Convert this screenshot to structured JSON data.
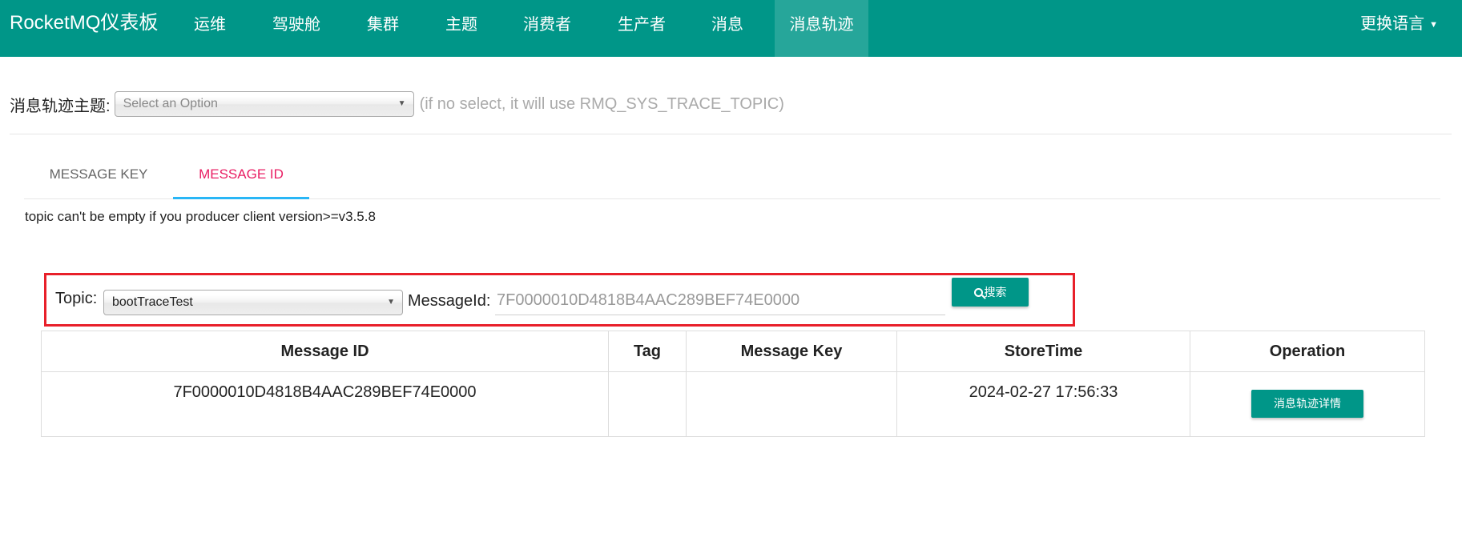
{
  "colors": {
    "primary": "#009688",
    "active_tab": "#e91e63",
    "tab_underline": "#29b6f6",
    "highlight_box": "#e8202a"
  },
  "navbar": {
    "brand": "RocketMQ仪表板",
    "items": [
      {
        "label": "运维"
      },
      {
        "label": "驾驶舱"
      },
      {
        "label": "集群"
      },
      {
        "label": "主题"
      },
      {
        "label": "消费者"
      },
      {
        "label": "生产者"
      },
      {
        "label": "消息"
      },
      {
        "label": "消息轨迹",
        "active": true
      }
    ],
    "language_label": "更换语言"
  },
  "trace_topic": {
    "label": "消息轨迹主题:",
    "placeholder": "Select an Option",
    "hint": "(if no select, it will use RMQ_SYS_TRACE_TOPIC)"
  },
  "tabs": [
    {
      "label": "MESSAGE KEY"
    },
    {
      "label": "MESSAGE ID",
      "active": true
    }
  ],
  "notice": "topic can't be empty if you producer client version>=v3.5.8",
  "search": {
    "topic_label": "Topic:",
    "topic_value": "bootTraceTest",
    "messageid_label": "MessageId:",
    "messageid_value": "7F0000010D4818B4AAC289BEF74E0000",
    "search_button": "搜索",
    "search_icon": "search-icon"
  },
  "table": {
    "headers": [
      "Message ID",
      "Tag",
      "Message Key",
      "StoreTime",
      "Operation"
    ],
    "rows": [
      {
        "message_id": "7F0000010D4818B4AAC289BEF74E0000",
        "tag": "",
        "message_key": "",
        "store_time": "2024-02-27 17:56:33",
        "operation": "消息轨迹详情"
      }
    ]
  }
}
